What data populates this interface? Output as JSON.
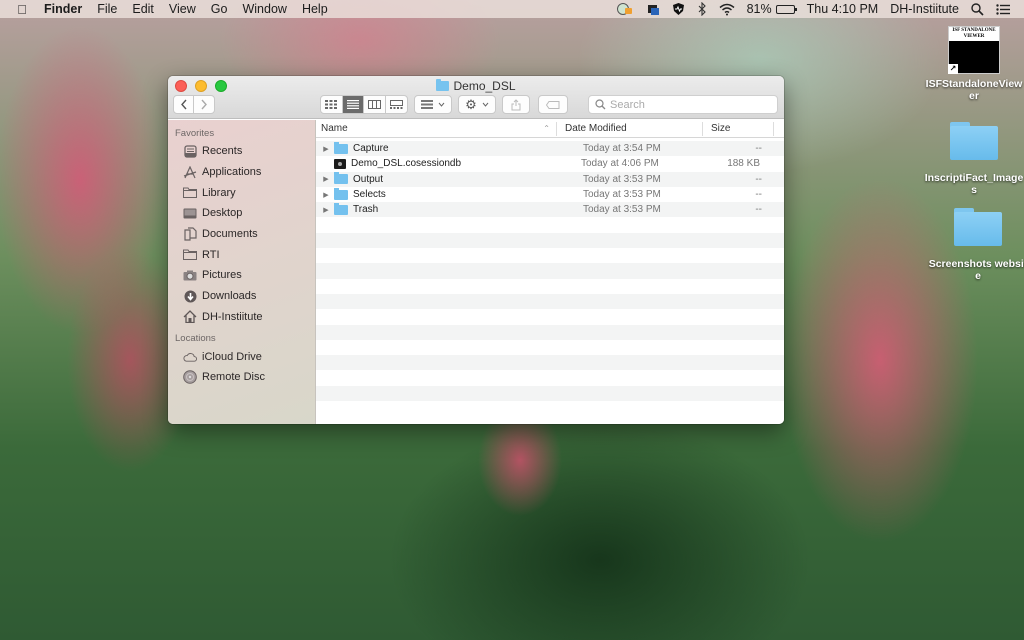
{
  "menubar": {
    "app_name": "Finder",
    "menus": [
      "File",
      "Edit",
      "View",
      "Go",
      "Window",
      "Help"
    ],
    "battery_percent": "81%",
    "battery_level": 0.81,
    "clock": "Thu 4:10 PM",
    "user": "DH-Instiitute",
    "tray_icons": [
      "time-machine-icon",
      "app-tray-icon",
      "shield-icon",
      "bluetooth-icon",
      "wifi-icon"
    ]
  },
  "desktop": {
    "icons": [
      {
        "label": "ISFStandaloneViewer",
        "kind": "alias-app",
        "thumb_title": "ISF STANDALONE VIEWER"
      },
      {
        "label": "InscriptiFact_Images",
        "kind": "folder"
      },
      {
        "label": "Screenshots website",
        "kind": "folder"
      }
    ]
  },
  "window": {
    "title": "Demo_DSL",
    "search_placeholder": "Search",
    "view_modes": [
      "icon-view",
      "list-view",
      "column-view",
      "gallery-view"
    ],
    "active_view": "list-view",
    "sidebar": {
      "favorites_heading": "Favorites",
      "favorites": [
        {
          "label": "Recents",
          "icon": "recents-icon"
        },
        {
          "label": "Applications",
          "icon": "applications-icon"
        },
        {
          "label": "Library",
          "icon": "folder-icon"
        },
        {
          "label": "Desktop",
          "icon": "desktop-icon"
        },
        {
          "label": "Documents",
          "icon": "documents-icon"
        },
        {
          "label": "RTI",
          "icon": "folder-icon"
        },
        {
          "label": "Pictures",
          "icon": "camera-icon"
        },
        {
          "label": "Downloads",
          "icon": "download-icon"
        },
        {
          "label": "DH-Instiitute",
          "icon": "home-icon"
        }
      ],
      "locations_heading": "Locations",
      "locations": [
        {
          "label": "iCloud Drive",
          "icon": "cloud-icon"
        },
        {
          "label": "Remote Disc",
          "icon": "disc-icon"
        }
      ]
    },
    "columns": {
      "name": "Name",
      "date": "Date Modified",
      "size": "Size"
    },
    "files": [
      {
        "name": "Capture",
        "type": "folder",
        "date": "Today at 3:54 PM",
        "size": "--"
      },
      {
        "name": "Demo_DSL.cosessiondb",
        "type": "file",
        "date": "Today at 4:06 PM",
        "size": "188 KB"
      },
      {
        "name": "Output",
        "type": "folder",
        "date": "Today at 3:53 PM",
        "size": "--"
      },
      {
        "name": "Selects",
        "type": "folder",
        "date": "Today at 3:53 PM",
        "size": "--"
      },
      {
        "name": "Trash",
        "type": "folder",
        "date": "Today at 3:53 PM",
        "size": "--"
      }
    ]
  }
}
